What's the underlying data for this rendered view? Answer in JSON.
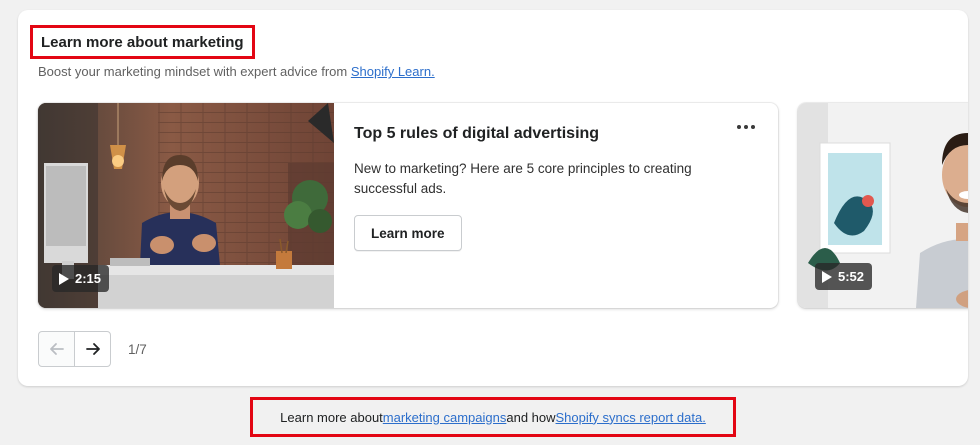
{
  "section": {
    "title": "Learn more about marketing",
    "subtitle_prefix": "Boost your marketing mindset with expert advice from ",
    "subtitle_link": "Shopify Learn."
  },
  "videos": [
    {
      "duration": "2:15",
      "title": "Top 5 rules of digital advertising",
      "description": "New to marketing? Here are 5 core principles to creating successful ads.",
      "button_label": "Learn more",
      "menu_icon": "more-horizontal-icon"
    },
    {
      "duration": "5:52"
    }
  ],
  "pager": {
    "indicator": "1/7",
    "prev_icon": "arrow-left-icon",
    "next_icon": "arrow-right-icon"
  },
  "footer": {
    "prefix": "Learn more about ",
    "link1": "marketing campaigns",
    "middle": " and how ",
    "link2": "Shopify syncs report data."
  },
  "colors": {
    "highlight": "#e30613",
    "link": "#2c6ecb",
    "background": "#f1f1f1"
  }
}
